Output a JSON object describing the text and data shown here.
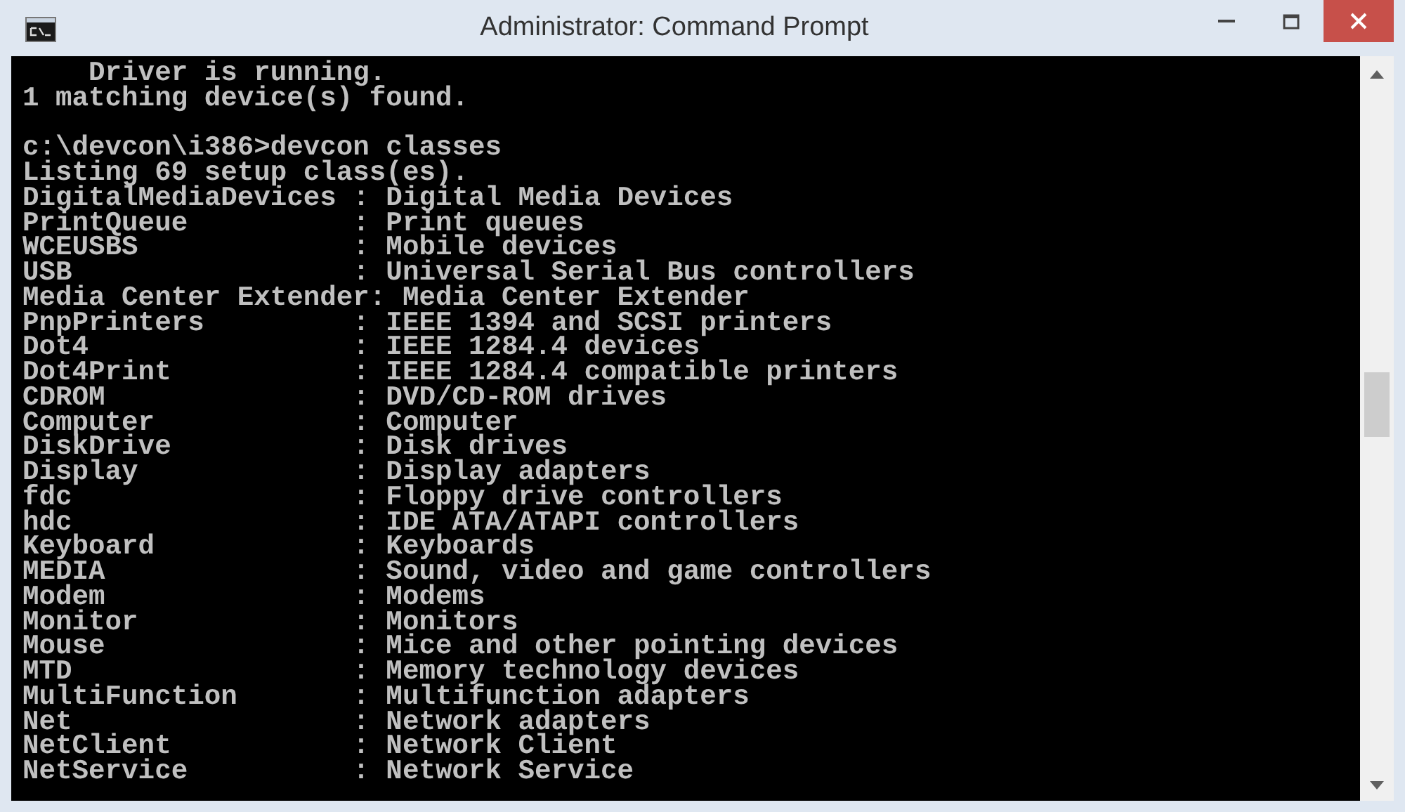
{
  "window": {
    "title": "Administrator: Command Prompt"
  },
  "console": {
    "blocks": [
      [
        "    Driver is running.",
        "1 matching device(s) found."
      ],
      [
        "c:\\devcon\\i386>devcon classes",
        "Listing 69 setup class(es).",
        "DigitalMediaDevices : Digital Media Devices",
        "PrintQueue          : Print queues",
        "WCEUSBS             : Mobile devices",
        "USB                 : Universal Serial Bus controllers",
        "Media Center Extender: Media Center Extender",
        "PnpPrinters         : IEEE 1394 and SCSI printers",
        "Dot4                : IEEE 1284.4 devices",
        "Dot4Print           : IEEE 1284.4 compatible printers",
        "CDROM               : DVD/CD-ROM drives",
        "Computer            : Computer",
        "DiskDrive           : Disk drives",
        "Display             : Display adapters",
        "fdc                 : Floppy drive controllers",
        "hdc                 : IDE ATA/ATAPI controllers",
        "Keyboard            : Keyboards",
        "MEDIA               : Sound, video and game controllers",
        "Modem               : Modems",
        "Monitor             : Monitors",
        "Mouse               : Mice and other pointing devices",
        "MTD                 : Memory technology devices",
        "MultiFunction       : Multifunction adapters",
        "Net                 : Network adapters",
        "NetClient           : Network Client",
        "NetService          : Network Service"
      ]
    ]
  }
}
